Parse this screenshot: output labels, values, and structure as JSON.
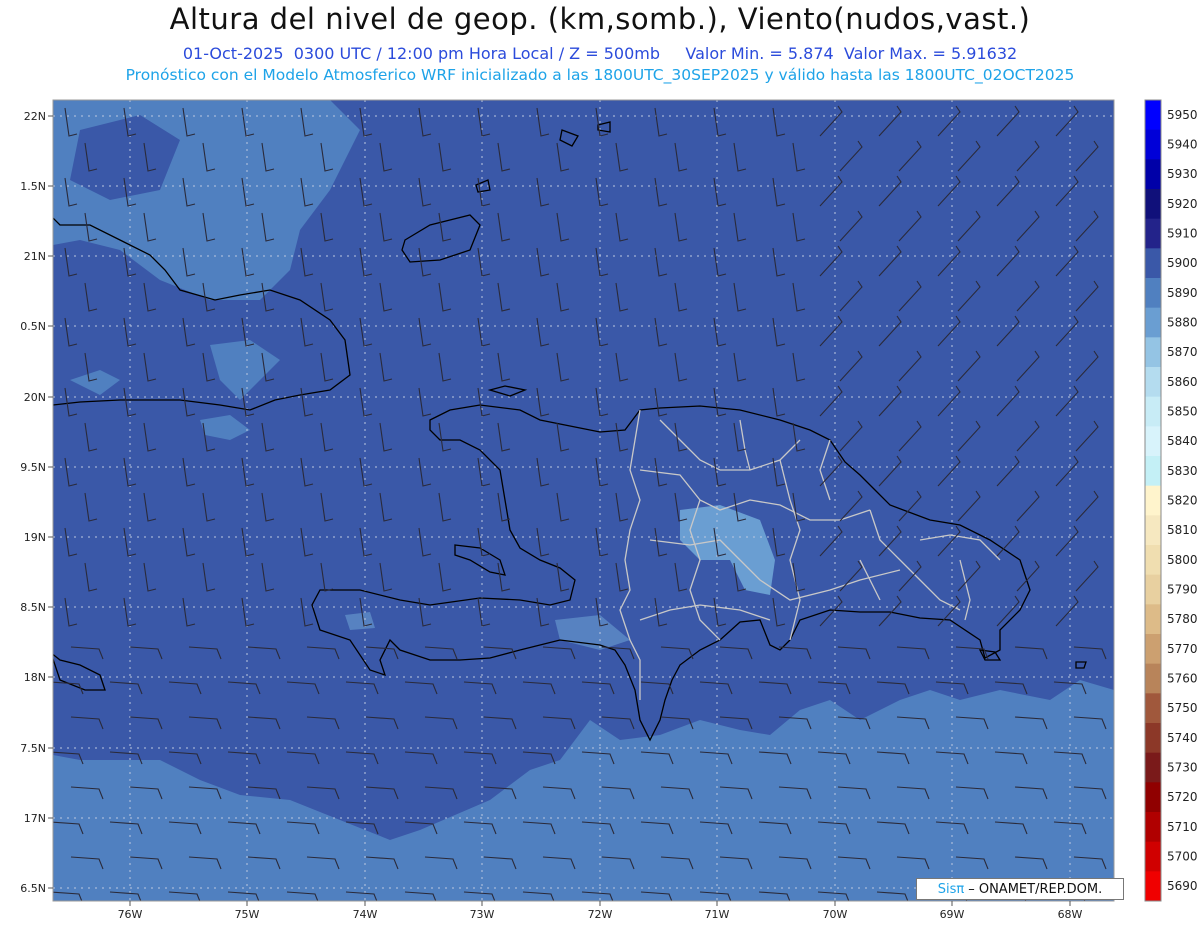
{
  "header": {
    "title": "Altura del nivel de geop. (km,somb.), Viento(nudos,vast.)",
    "subtitle_left": "01-Oct-2025  0300 UTC / 12:00 pm Hora Local / Z = 500mb",
    "subtitle_right": "Valor Min. = 5.874  Valor Max. = 5.91632",
    "forecast_line": "Pronóstico con el Modelo Atmosferico WRF inicializado a las 1800UTC_30SEP2025 y válido hasta las  1800UTC_02OCT2025"
  },
  "map": {
    "lat_labels": [
      "22N",
      "1.5N",
      "21N",
      "0.5N",
      "20N",
      "9.5N",
      "19N",
      "8.5N",
      "18N",
      "7.5N",
      "17N",
      "6.5N"
    ],
    "lat_values": [
      22,
      21.5,
      21,
      20.5,
      20,
      19.5,
      19,
      18.5,
      18,
      17.5,
      17,
      16.5
    ],
    "lon_labels": [
      "76W",
      "75W",
      "74W",
      "73W",
      "72W",
      "71W",
      "70W",
      "69W",
      "68W"
    ],
    "lon_values": [
      -76,
      -75,
      -74,
      -73,
      -72,
      -71,
      -70,
      -69,
      -68
    ],
    "field_colors": {
      "5900": "#3a58a8",
      "5890": "#5080c0",
      "5880": "#6a9ed2"
    }
  },
  "colorbar": {
    "levels": [
      "5950",
      "5940",
      "5930",
      "5920",
      "5910",
      "5900",
      "5890",
      "5880",
      "5870",
      "5860",
      "5850",
      "5840",
      "5830",
      "5820",
      "5810",
      "5800",
      "5790",
      "5780",
      "5770",
      "5760",
      "5750",
      "5740",
      "5730",
      "5720",
      "5710",
      "5700",
      "5690"
    ],
    "colors": [
      "#0000ff",
      "#0000d8",
      "#0000a8",
      "#10107a",
      "#23238a",
      "#3a58a8",
      "#5080c0",
      "#6a9ed2",
      "#94c4e4",
      "#b4dcef",
      "#c8ecf6",
      "#d8f3fb",
      "#c4f0f6",
      "#fff4cc",
      "#f6e8c0",
      "#f0deb0",
      "#e8d0a0",
      "#ddbb88",
      "#cca070",
      "#b8845a",
      "#a0583c",
      "#8c3828",
      "#7a1a1a",
      "#900000",
      "#b00000",
      "#d00000",
      "#f00000"
    ]
  },
  "credit": {
    "logo": "Sisπ",
    "text": "– ONAMET/REP.DOM."
  }
}
